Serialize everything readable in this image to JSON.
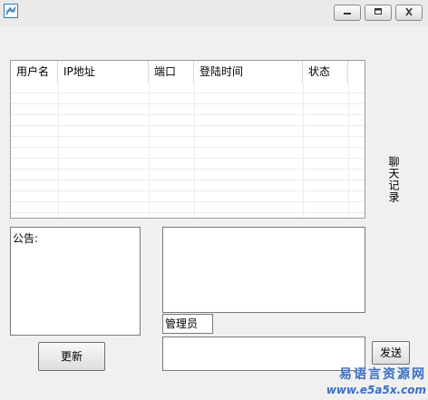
{
  "window": {
    "icon": "app-window-icon",
    "controls": [
      {
        "name": "minimize",
        "icon": "minimize-icon"
      },
      {
        "name": "maximize",
        "icon": "maximize-icon"
      },
      {
        "name": "close",
        "icon": "close-icon"
      }
    ]
  },
  "user_list": {
    "columns": [
      "用户名",
      "IP地址",
      "端口",
      "登陆时间",
      "状态"
    ],
    "rows": []
  },
  "side_label": "聊天记录",
  "notice_box": {
    "value": "公告:"
  },
  "refresh_button": {
    "label": "更新"
  },
  "chat_log": {
    "value": ""
  },
  "sender_field": {
    "value": "管理员"
  },
  "message_input": {
    "value": ""
  },
  "send_button": {
    "label": "发送"
  },
  "watermark": {
    "line1": "易语言资源网",
    "line2": "www.e5a5x.com"
  },
  "colors": {
    "background": "#f0f0f0",
    "watermark": "#3a6fc4"
  }
}
